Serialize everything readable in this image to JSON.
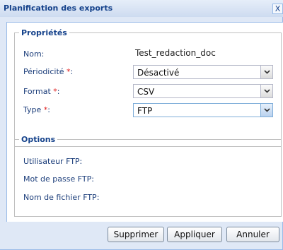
{
  "dialog": {
    "title": "Planification des exports",
    "close_glyph": "X"
  },
  "properties": {
    "legend": "Propriétés",
    "name_label": "Nom:",
    "name_value": "Test_redaction_doc",
    "periodicity_label": "Périodicité",
    "periodicity_value": "Désactivé",
    "format_label": "Format",
    "format_value": "CSV",
    "type_label": "Type",
    "type_value": "FTP",
    "required_marker": "*",
    "colon": ":"
  },
  "options": {
    "legend": "Options",
    "ftp_user_label": "Utilisateur FTP:",
    "ftp_password_label": "Mot de passe FTP:",
    "ftp_filename_label": "Nom de fichier FTP:"
  },
  "buttons": {
    "delete": "Supprimer",
    "apply": "Appliquer",
    "cancel": "Annuler"
  },
  "icons": {
    "close": "close-icon",
    "dropdown": "chevron-down-icon"
  },
  "colors": {
    "title_text": "#15428b",
    "label_text": "#1b3d7a",
    "required": "#e02020",
    "window_bg": "#dfe8f6"
  }
}
